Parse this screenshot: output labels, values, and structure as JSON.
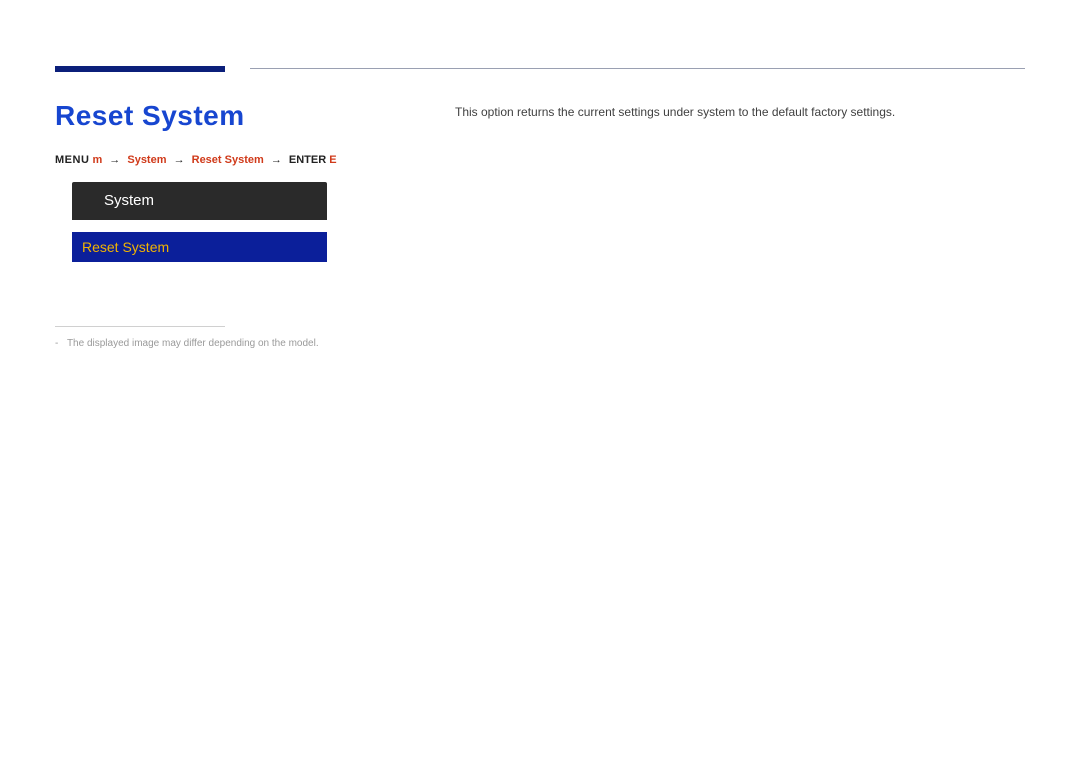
{
  "section": {
    "title": "Reset System"
  },
  "menu_line": {
    "prefix_label": "MENU",
    "prefix_glyph": "m",
    "arrow": "→",
    "item1": "System",
    "item2": "Reset System",
    "enter_label": "ENTER",
    "enter_glyph": "E"
  },
  "osd": {
    "header": "System",
    "selected": "Reset System"
  },
  "footnote": {
    "dash": "-",
    "text": "The displayed image may differ depending on the model."
  },
  "description": "This option returns the current settings under system to the default factory settings."
}
